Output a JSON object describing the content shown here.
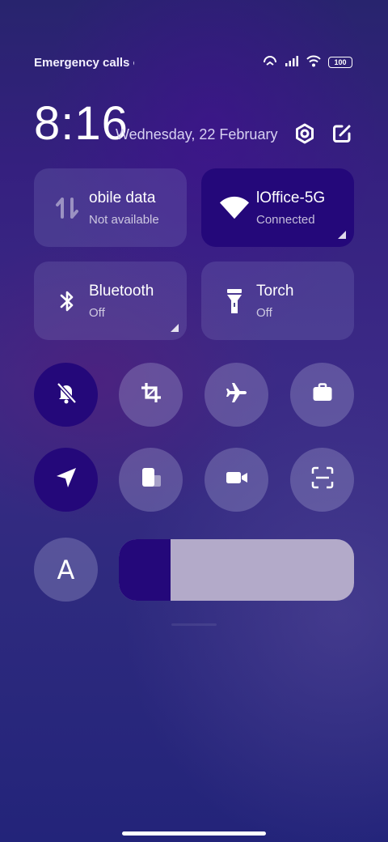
{
  "status_bar": {
    "carrier_text": "Emergency calls o",
    "battery": "100",
    "icons": [
      "hotspot-icon",
      "signal-icon",
      "wifi-icon",
      "battery-icon"
    ]
  },
  "header": {
    "time": "8:16",
    "date": "Wednesday, 22 February",
    "icons": [
      "settings-icon",
      "edit-icon"
    ]
  },
  "tiles": [
    {
      "name": "mobile-data",
      "title": "obile data",
      "subtitle": "Not available",
      "active": false,
      "icon": "mobile-data-icon"
    },
    {
      "name": "wifi",
      "title": "lOffice-5G",
      "subtitle": "Connected",
      "active": true,
      "icon": "wifi-icon"
    },
    {
      "name": "bluetooth",
      "title": "Bluetooth",
      "subtitle": "Off",
      "active": false,
      "icon": "bluetooth-icon"
    },
    {
      "name": "torch",
      "title": "Torch",
      "subtitle": "Off",
      "active": false,
      "icon": "torch-icon"
    }
  ],
  "toggles": [
    {
      "name": "mute",
      "icon": "bell-off-icon",
      "active": true
    },
    {
      "name": "crop-screenshot",
      "icon": "crop-icon",
      "active": false
    },
    {
      "name": "airplane-mode",
      "icon": "airplane-icon",
      "active": false
    },
    {
      "name": "work-mode",
      "icon": "briefcase-icon",
      "active": false
    },
    {
      "name": "location",
      "icon": "location-arrow-icon",
      "active": true
    },
    {
      "name": "floating-window",
      "icon": "floating-window-icon",
      "active": false
    },
    {
      "name": "screen-recorder",
      "icon": "video-camera-icon",
      "active": false
    },
    {
      "name": "scanner",
      "icon": "scan-icon",
      "active": false
    }
  ],
  "auto_brightness": {
    "label": "A",
    "icon": "auto-brightness-icon"
  },
  "brightness": {
    "level": 0.22
  },
  "colors": {
    "accent": "#24087a",
    "tile_inactive": "#4b4a8c",
    "slider_track": "#b3aac9"
  }
}
